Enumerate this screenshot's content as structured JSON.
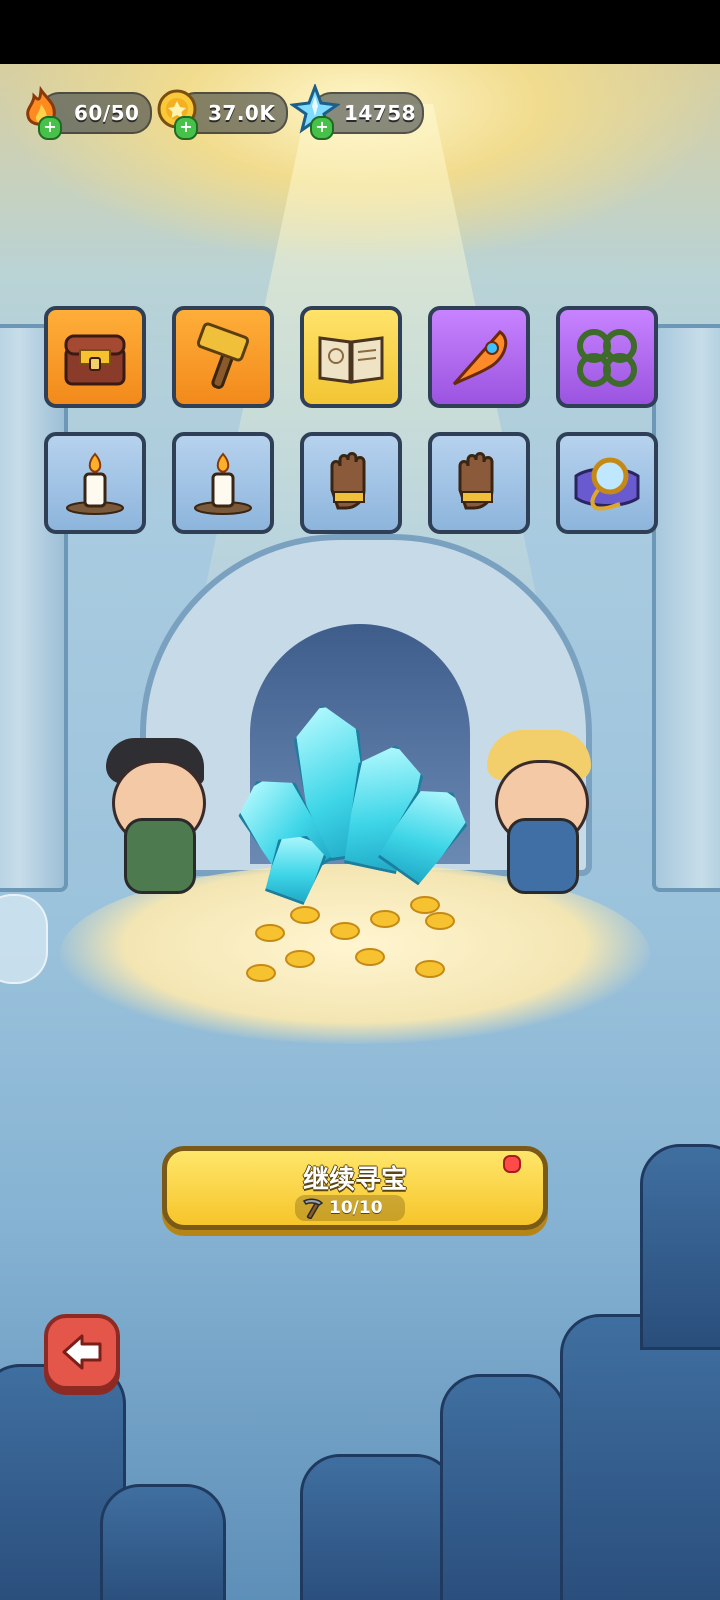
{
  "hud": {
    "energy": {
      "icon": "flame-icon",
      "value": "60/50"
    },
    "gold": {
      "icon": "gold-coin-icon",
      "value": "37.0K"
    },
    "gems": {
      "icon": "blue-crystal-icon",
      "value": "14758"
    }
  },
  "items_row1": [
    {
      "name": "treasure-chest-icon",
      "rarity": "orange"
    },
    {
      "name": "hammer-icon",
      "rarity": "orange"
    },
    {
      "name": "spell-book-icon",
      "rarity": "yellow"
    },
    {
      "name": "phoenix-feather-icon",
      "rarity": "purple"
    },
    {
      "name": "thorn-shackles-icon",
      "rarity": "purple"
    }
  ],
  "items_row2": [
    {
      "name": "candle-icon",
      "rarity": "blue"
    },
    {
      "name": "candle-icon",
      "rarity": "blue"
    },
    {
      "name": "glove-icon",
      "rarity": "blue"
    },
    {
      "name": "glove-icon",
      "rarity": "blue"
    },
    {
      "name": "magnifier-icon",
      "rarity": "blue"
    }
  ],
  "continue_button": {
    "label": "继续寻宝",
    "count": "10/10",
    "icon": "pickaxe-icon"
  },
  "colors": {
    "button_yellow": "#f6c52a",
    "back_red": "#e4554a",
    "crystal_cyan": "#3fd6e8"
  }
}
